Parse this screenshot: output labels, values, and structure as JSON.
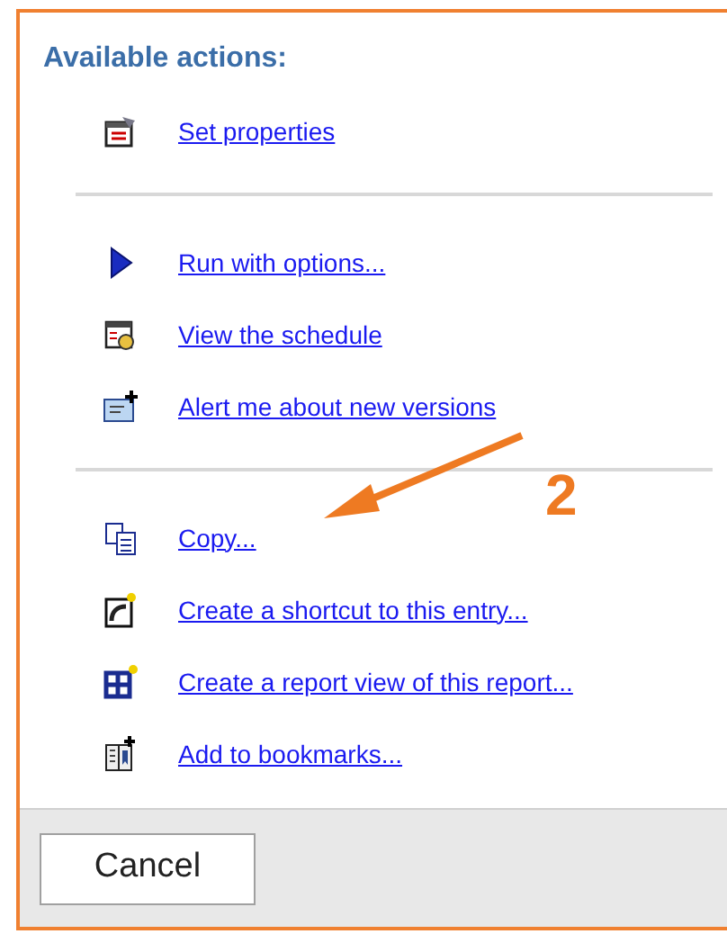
{
  "heading": "Available actions:",
  "groups": [
    {
      "items": [
        {
          "label": "Set properties",
          "kind": "properties"
        }
      ]
    },
    {
      "items": [
        {
          "label": "Run with options...",
          "kind": "run"
        },
        {
          "label": "View the schedule",
          "kind": "schedule"
        },
        {
          "label": "Alert me about new versions",
          "kind": "alert"
        }
      ]
    },
    {
      "items": [
        {
          "label": "Copy...",
          "kind": "copy"
        },
        {
          "label": "Create a shortcut to this entry...",
          "kind": "shortcut"
        },
        {
          "label": "Create a report view of this report...",
          "kind": "reportview"
        },
        {
          "label": "Add to bookmarks...",
          "kind": "bookmark"
        }
      ]
    }
  ],
  "annotation": {
    "number": "2"
  },
  "footer": {
    "button": "Cancel"
  }
}
